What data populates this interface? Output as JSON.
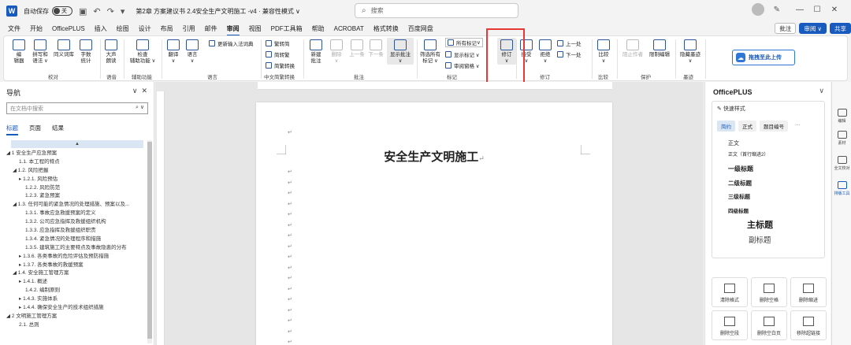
{
  "titlebar": {
    "app_letter": "W",
    "autosave_label": "自动保存",
    "autosave_state": "关",
    "doc_title": "第2章 方案建议书 2.4安全生产文明施工 -v4 · 兼容性模式 ∨",
    "search_placeholder": "搜索"
  },
  "menu": {
    "tabs": [
      "文件",
      "开始",
      "OfficePLUS",
      "插入",
      "绘图",
      "设计",
      "布局",
      "引用",
      "邮件",
      "审阅",
      "视图",
      "PDF工具箱",
      "帮助",
      "ACROBAT",
      "格式转换",
      "百度网盘"
    ],
    "active_tab": "审阅",
    "comment_btn": "批注",
    "edit_btn": "审阅 ∨",
    "share_btn": "共享"
  },
  "ribbon": {
    "proofing": {
      "label": "校对",
      "spelling": "编\n辑器",
      "thesaurus": "拼写和\n语法 ∨",
      "synonyms": "同义词库",
      "wordcount": "字数\n统计"
    },
    "speech": {
      "label": "语音",
      "read_aloud": "大声\n朗读"
    },
    "accessibility": {
      "label": "辅助功能",
      "check": "检查\n辅助功能 ∨"
    },
    "language": {
      "label": "语言",
      "translate": "翻译\n∨",
      "language": "语言\n∨",
      "update_ime": "更新输入法词典"
    },
    "chinese": {
      "label": "中文简繁转换",
      "to_simplified": "繁转简",
      "to_traditional": "简转繁",
      "convert": "简繁转换"
    },
    "comments": {
      "label": "批注",
      "new": "新建\n批注",
      "delete": "删除\n∨",
      "prev": "上一条",
      "next": "下一条",
      "show": "显示批注\n∨"
    },
    "tracking": {
      "label": "标记",
      "filter": "筛选所有\n标记 ∨",
      "all_markup": "所有标记",
      "show_markup": "显示标记 ∨",
      "review_pane": "审阅窗格 ∨",
      "track_changes": "修订\n∨"
    },
    "changes": {
      "label": "修订",
      "accept": "接受\n∨",
      "reject": "拒绝\n∨",
      "prev": "上一处",
      "next": "下一处"
    },
    "compare": {
      "label": "比较",
      "compare": "比较\n∨"
    },
    "protect": {
      "label": "保护",
      "block_authors": "阻止作者",
      "restrict": "限制编辑"
    },
    "ink": {
      "label": "墨迹",
      "hide_ink": "隐藏墨迹\n∨"
    },
    "upload_btn": "拖拽至此上传"
  },
  "nav": {
    "title": "导航",
    "search_placeholder": "在文档中搜索",
    "tabs": [
      "标题",
      "页面",
      "结果"
    ],
    "active_tab": "标题",
    "items": [
      {
        "text": "◢  1 安全生产应急预案",
        "indent": 0
      },
      {
        "text": "1.1. 本工程的特点",
        "indent": 2
      },
      {
        "text": "◢  1.2. 风险把握",
        "indent": 1
      },
      {
        "text": "▸  1.2.1. 风险预估",
        "indent": 2
      },
      {
        "text": "1.2.2. 风险防范",
        "indent": 3
      },
      {
        "text": "1.2.3. 紧急预案",
        "indent": 3
      },
      {
        "text": "◢  1.3. 任何可能的紧急情况的处理措施、预案以及...",
        "indent": 1
      },
      {
        "text": "1.3.1. 事故应急救援预案的定义",
        "indent": 3
      },
      {
        "text": "1.3.2. 公司应急指挥及救援组织机构",
        "indent": 3
      },
      {
        "text": "1.3.3. 应急指挥及救援组织职责",
        "indent": 3
      },
      {
        "text": "1.3.4. 紧急情况的处理程序和措施",
        "indent": 3
      },
      {
        "text": "1.3.5. 建筑施工的主要特点及事故隐患的分布",
        "indent": 3
      },
      {
        "text": "▸  1.3.6. 各类事故的危险评估及预防措施",
        "indent": 2
      },
      {
        "text": "▸  1.3.7. 各类事故的救援预案",
        "indent": 2
      },
      {
        "text": "◢  1.4. 安全施工管理方案",
        "indent": 1
      },
      {
        "text": "▸  1.4.1. 概述",
        "indent": 2
      },
      {
        "text": "1.4.2. 编制原则",
        "indent": 3
      },
      {
        "text": "▸  1.4.3. 实施体系",
        "indent": 2
      },
      {
        "text": "▸  1.4.4. 确保安全生产的技术组织措施",
        "indent": 2
      },
      {
        "text": "◢  2 文明施工管理方案",
        "indent": 0
      },
      {
        "text": "2.1. 总则",
        "indent": 2
      }
    ]
  },
  "document": {
    "heading": "安全生产文明施工",
    "para_mark": "↵"
  },
  "rightpanel": {
    "title": "OfficePLUS",
    "quick_styles": "快速样式",
    "style_tabs": [
      "简约",
      "正式",
      "题目编号",
      "···"
    ],
    "styles": [
      "正文",
      "正文（首行缩进2）",
      "一级标题",
      "二级标题",
      "三级标题",
      "四级标题",
      "主标题",
      "副标题"
    ],
    "tools": [
      "清除格式",
      "删除空格",
      "删除缩进",
      "删除空段",
      "删除空白页",
      "移除超链接"
    ]
  },
  "sidebar": {
    "items": [
      "编辑",
      "素材",
      "全文校对",
      "排版工具"
    ],
    "active": "排版工具"
  },
  "colors": {
    "accent": "#185abd",
    "highlight": "#e53935"
  }
}
